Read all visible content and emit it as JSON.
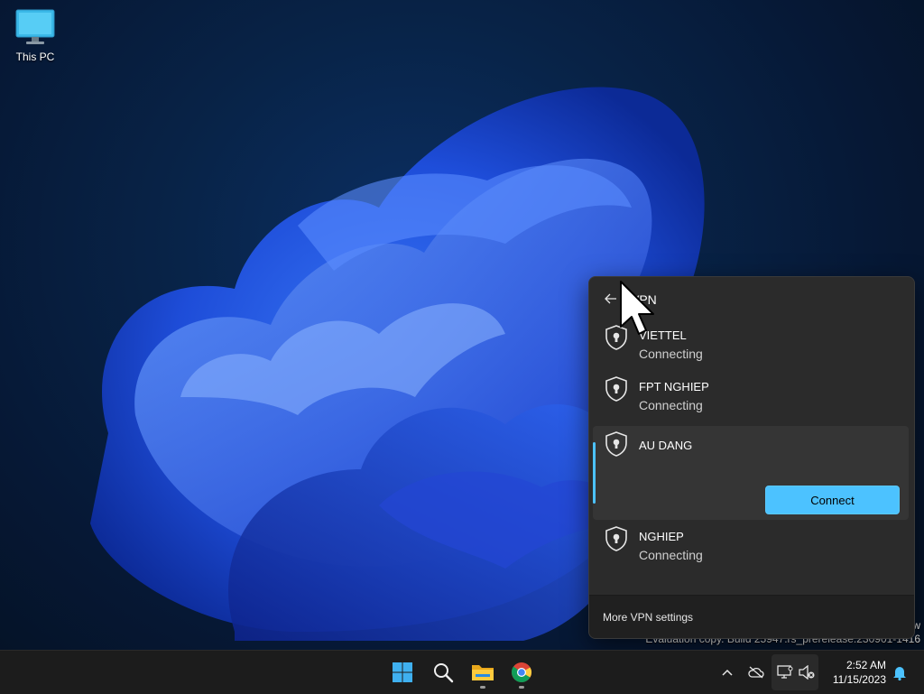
{
  "desktop": {
    "icons": [
      {
        "label": "This PC",
        "icon": "monitor-icon"
      }
    ],
    "watermark": {
      "line1": "w",
      "line2": "Evaluation copy. Build 25947.rs_prerelease.230901-1416"
    }
  },
  "vpn_flyout": {
    "title": "VPN",
    "back_icon": "arrow-left-icon",
    "connections": [
      {
        "name": "VIETTEL",
        "status": "Connecting",
        "icon": "shield-lock-icon"
      },
      {
        "name": "FPT NGHIEP",
        "status": "Connecting",
        "icon": "shield-lock-icon"
      },
      {
        "name": "AU DANG",
        "status": "",
        "icon": "shield-lock-icon",
        "selected": true,
        "action_label": "Connect"
      },
      {
        "name": "NGHIEP",
        "status": "Connecting",
        "icon": "shield-lock-icon"
      }
    ],
    "footer_link": "More VPN settings"
  },
  "taskbar": {
    "apps": [
      {
        "name": "Start",
        "icon": "windows-logo-icon"
      },
      {
        "name": "Search",
        "icon": "search-icon"
      },
      {
        "name": "File Explorer",
        "icon": "folder-icon",
        "running": true
      },
      {
        "name": "Google Chrome",
        "icon": "chrome-icon",
        "running": true
      }
    ],
    "tray": {
      "icons": [
        "chevron-up-icon",
        "cloud-offline-icon",
        "network-icon",
        "volume-muted-icon",
        "bell-icon"
      ]
    },
    "clock": {
      "time": "2:52 AM",
      "date": "11/15/2023"
    }
  },
  "colors": {
    "accent": "#4cc2ff",
    "flyout_bg": "#2b2b2b",
    "taskbar_bg": "#1c1c1c"
  }
}
